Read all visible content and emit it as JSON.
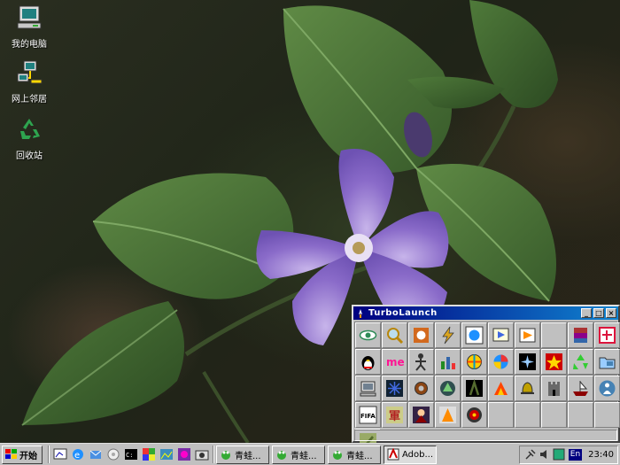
{
  "desktop": {
    "icons": [
      {
        "label": "我的电脑",
        "icon": "my-computer-icon"
      },
      {
        "label": "网上邻居",
        "icon": "network-neighborhood-icon"
      },
      {
        "label": "回收站",
        "icon": "recycle-bin-icon"
      }
    ]
  },
  "turbolaunch": {
    "title": "TurboLaunch",
    "buttons": {
      "minimize": "_",
      "maximize": "□",
      "close": "×"
    },
    "launchers": [
      {
        "icon": "eye-icon",
        "color": "#2e8b57"
      },
      {
        "icon": "magnifier-icon",
        "color": "#b8860b"
      },
      {
        "icon": "stop-sign-icon",
        "color": "#d2691e"
      },
      {
        "icon": "lightning-icon",
        "color": "#daa520"
      },
      {
        "icon": "ie-browser-icon",
        "color": "#1e90ff"
      },
      {
        "icon": "media-player-icon",
        "color": "#4169e1"
      },
      {
        "icon": "play-icon",
        "color": "#ff8c00"
      },
      {
        "icon": "empty",
        "color": ""
      },
      {
        "icon": "winrar-icon",
        "color": "#8b008b"
      },
      {
        "icon": "network-tool-icon",
        "color": "#dc143c"
      },
      {
        "icon": "qq-penguin-icon",
        "color": "#000000"
      },
      {
        "icon": "me-icon",
        "color": "#ff1493"
      },
      {
        "icon": "stick-figure-icon",
        "color": "#333333"
      },
      {
        "icon": "chart-icon",
        "color": "#228b22"
      },
      {
        "icon": "ball-icon",
        "color": "#ff4500"
      },
      {
        "icon": "wheel-icon",
        "color": "#1e90ff"
      },
      {
        "icon": "sparkle-icon",
        "color": "#4b0082"
      },
      {
        "icon": "star-icon",
        "color": "#ffd700"
      },
      {
        "icon": "recycle-icon",
        "color": "#32cd32"
      },
      {
        "icon": "folder-icon",
        "color": "#4682b4"
      },
      {
        "icon": "computer-icon",
        "color": "#708090"
      },
      {
        "icon": "snowflake-icon",
        "color": "#4169e1"
      },
      {
        "icon": "gear-icon",
        "color": "#8b4513"
      },
      {
        "icon": "round-icon",
        "color": "#2f4f4f"
      },
      {
        "icon": "soldier-icon",
        "color": "#556b2f"
      },
      {
        "icon": "fire-icon",
        "color": "#ff4500"
      },
      {
        "icon": "bell-icon",
        "color": "#c0a000"
      },
      {
        "icon": "castle-icon",
        "color": "#696969"
      },
      {
        "icon": "ship-icon",
        "color": "#8b0000"
      },
      {
        "icon": "people-icon",
        "color": "#4682b4"
      },
      {
        "icon": "fifa-icon",
        "color": "#000000"
      },
      {
        "icon": "sword-icon",
        "color": "#b22222"
      },
      {
        "icon": "warrior-icon",
        "color": "#8b0000"
      },
      {
        "icon": "figure-icon",
        "color": "#ff8c00"
      },
      {
        "icon": "target-icon",
        "color": "#cc0000"
      },
      {
        "icon": "empty",
        "color": ""
      },
      {
        "icon": "empty",
        "color": ""
      },
      {
        "icon": "empty",
        "color": ""
      },
      {
        "icon": "empty",
        "color": ""
      },
      {
        "icon": "empty",
        "color": ""
      },
      {
        "icon": "pen-icon",
        "color": "#556b2f"
      }
    ]
  },
  "taskbar": {
    "start_label": "开始",
    "tasks": [
      {
        "label": "青蛙...",
        "icon": "frog-icon",
        "active": false
      },
      {
        "label": "青蛙...",
        "icon": "frog-icon",
        "active": false
      },
      {
        "label": "青蛙...",
        "icon": "frog-icon",
        "active": false
      },
      {
        "label": "Adob...",
        "icon": "adobe-icon",
        "active": true
      }
    ],
    "tray": {
      "lang": "En",
      "clock": "23:40"
    }
  }
}
